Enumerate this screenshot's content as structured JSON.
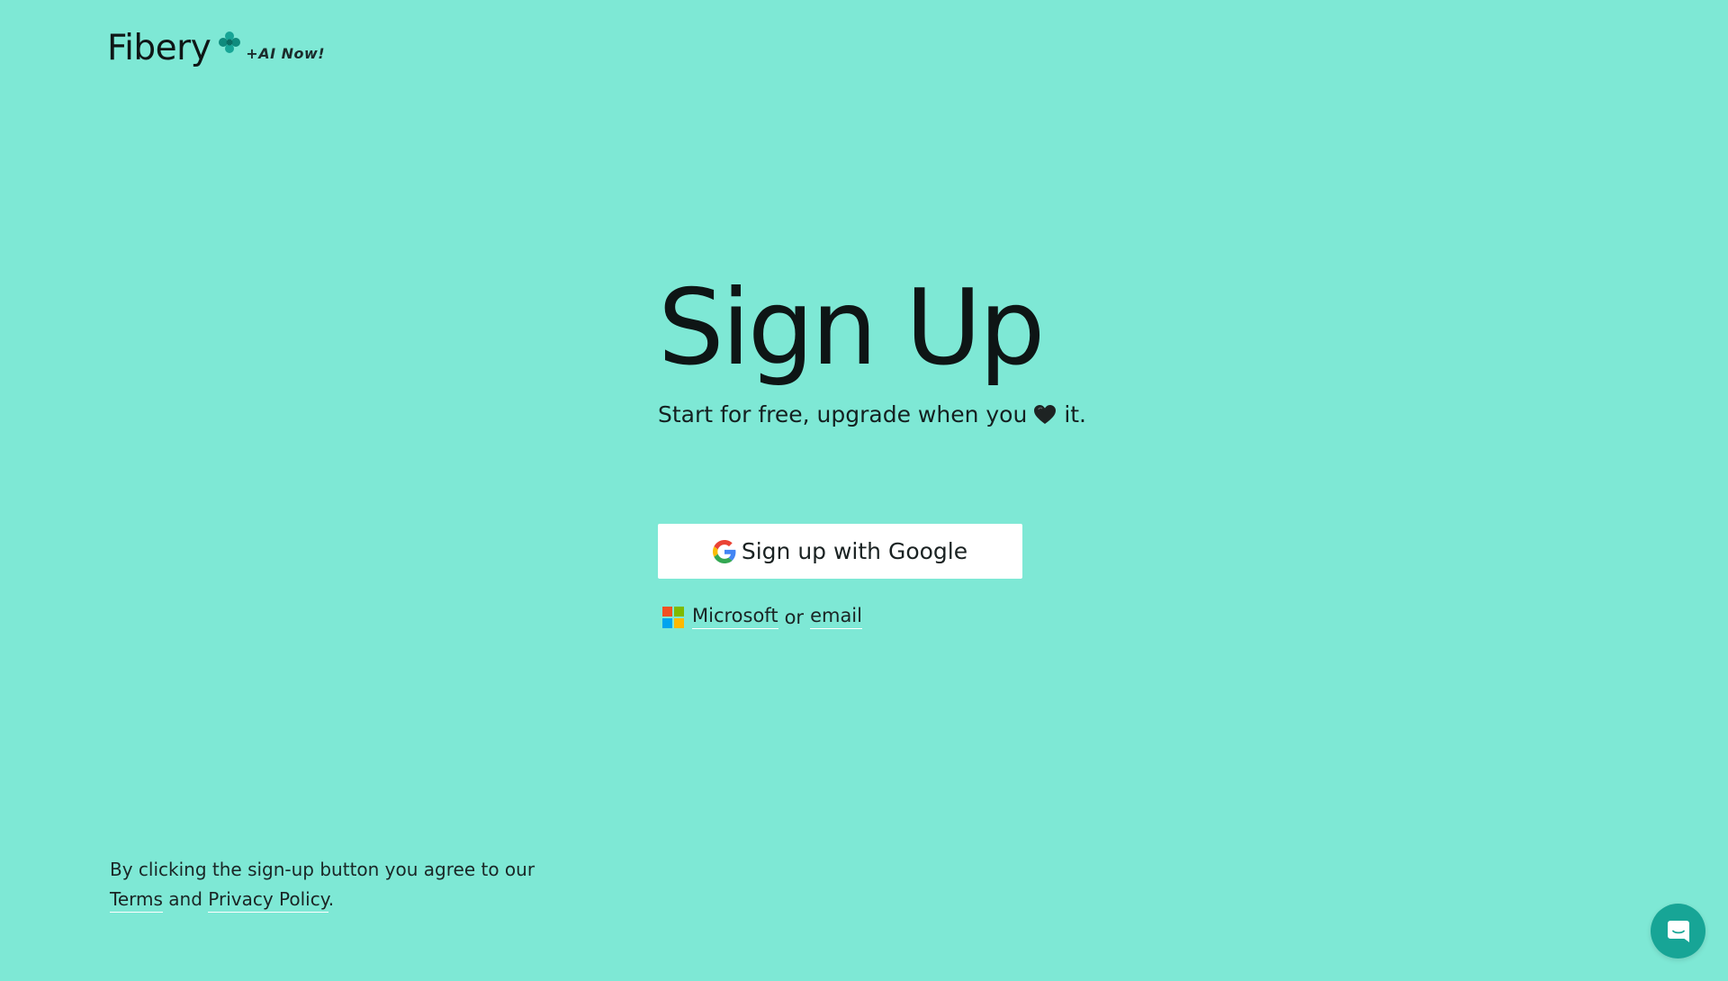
{
  "header": {
    "logo_text": "Fibery",
    "logo_badge": "+AI Now!",
    "brand_color": "#17a596"
  },
  "main": {
    "title": "Sign Up",
    "subtitle_before": "Start for free, upgrade when you",
    "subtitle_after": "it.",
    "subtitle_icon": "black-heart-icon",
    "google_button_label": "Sign up with Google",
    "microsoft_link": "Microsoft",
    "or_text": "or",
    "email_link": "email"
  },
  "footer": {
    "line1": "By clicking the sign-up button you agree to our",
    "terms_link": "Terms",
    "and_text": "and",
    "privacy_link": "Privacy Policy",
    "period": "."
  },
  "chat": {
    "icon": "chat-bubble-icon"
  },
  "colors": {
    "background": "#7ee8d5",
    "button_background": "#ffffff",
    "text": "#111a1a"
  }
}
